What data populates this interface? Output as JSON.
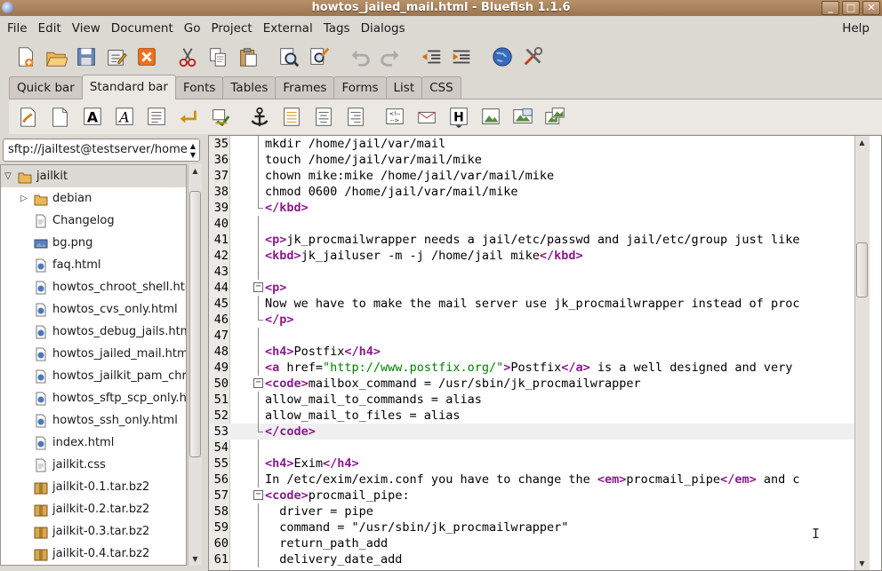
{
  "window": {
    "title": "howtos_jailed_mail.html - Bluefish 1.1.6",
    "minimize": "_",
    "maximize": "□",
    "close": "✕"
  },
  "menubar": [
    "File",
    "Edit",
    "View",
    "Document",
    "Go",
    "Project",
    "External",
    "Tags",
    "Dialogs"
  ],
  "menubar_right": "Help",
  "toolbar_icons": [
    "new-file-icon",
    "open-file-icon",
    "save-icon",
    "save-as-icon",
    "close-file-icon",
    "cut-icon",
    "copy-icon",
    "paste-icon",
    "find-icon",
    "replace-icon",
    "undo-icon",
    "redo-icon",
    "unindent-icon",
    "indent-icon",
    "preview-browser-icon",
    "preferences-icon"
  ],
  "tabs": [
    "Quick bar",
    "Standard bar",
    "Fonts",
    "Tables",
    "Frames",
    "Forms",
    "List",
    "CSS"
  ],
  "active_tab": "Standard bar",
  "tag_icons": [
    "quickstart-icon",
    "body-icon",
    "bold-icon",
    "italic-icon",
    "paragraph-icon",
    "break-icon",
    "nbsp-icon",
    "anchor-icon",
    "anchor-tag-icon",
    "align-center-icon",
    "align-right-icon",
    "comment-icon",
    "email-icon",
    "heading-icon",
    "image-icon",
    "thumbnail-icon",
    "multi-thumbnail-icon"
  ],
  "sidebar": {
    "path": "sftp://jailtest@testserver/home",
    "items": [
      {
        "label": "jailkit",
        "type": "folder",
        "expanded": true,
        "level": 0
      },
      {
        "label": "debian",
        "type": "folder",
        "expanded": false,
        "level": 1
      },
      {
        "label": "Changelog",
        "type": "text",
        "level": 1
      },
      {
        "label": "bg.png",
        "type": "image",
        "level": 1
      },
      {
        "label": "faq.html",
        "type": "html",
        "level": 1
      },
      {
        "label": "howtos_chroot_shell.htm",
        "type": "html",
        "level": 1
      },
      {
        "label": "howtos_cvs_only.html",
        "type": "html",
        "level": 1
      },
      {
        "label": "howtos_debug_jails.htm",
        "type": "html",
        "level": 1
      },
      {
        "label": "howtos_jailed_mail.htm",
        "type": "html",
        "level": 1
      },
      {
        "label": "howtos_jailkit_pam_chro",
        "type": "html",
        "level": 1
      },
      {
        "label": "howtos_sftp_scp_only.h",
        "type": "html",
        "level": 1
      },
      {
        "label": "howtos_ssh_only.html",
        "type": "html",
        "level": 1
      },
      {
        "label": "index.html",
        "type": "html",
        "level": 1
      },
      {
        "label": "jailkit.css",
        "type": "text",
        "level": 1
      },
      {
        "label": "jailkit-0.1.tar.bz2",
        "type": "archive",
        "level": 1
      },
      {
        "label": "jailkit-0.2.tar.bz2",
        "type": "archive",
        "level": 1
      },
      {
        "label": "jailkit-0.3.tar.bz2",
        "type": "archive",
        "level": 1
      },
      {
        "label": "jailkit-0.4.tar.bz2",
        "type": "archive",
        "level": 1
      }
    ]
  },
  "editor": {
    "current_line": 53,
    "lines": [
      {
        "n": "35",
        "fold": "line",
        "parts": [
          [
            "t",
            "mkdir /home/jail/var/mail"
          ]
        ]
      },
      {
        "n": "36",
        "fold": "line",
        "parts": [
          [
            "t",
            "touch /home/jail/var/mail/mike"
          ]
        ]
      },
      {
        "n": "37",
        "fold": "line",
        "parts": [
          [
            "t",
            "chown mike:mike /home/jail/var/mail/mike"
          ]
        ]
      },
      {
        "n": "38",
        "fold": "line",
        "parts": [
          [
            "t",
            "chmod 0600 /home/jail/var/mail/mike"
          ]
        ]
      },
      {
        "n": "39",
        "fold": "end",
        "parts": [
          [
            "k",
            "</kbd>"
          ]
        ]
      },
      {
        "n": "40",
        "fold": "line",
        "parts": []
      },
      {
        "n": "41",
        "fold": "line",
        "parts": [
          [
            "k",
            "<p>"
          ],
          [
            "t",
            "jk_procmailwrapper needs a jail/etc/passwd and jail/etc/group just like"
          ]
        ]
      },
      {
        "n": "42",
        "fold": "line",
        "parts": [
          [
            "k",
            "<kbd>"
          ],
          [
            "t",
            "jk_jailuser -m -j /home/jail mike"
          ],
          [
            "k",
            "</kbd>"
          ]
        ]
      },
      {
        "n": "43",
        "fold": "line",
        "parts": []
      },
      {
        "n": "44",
        "fold": "start",
        "parts": [
          [
            "k",
            "<p>"
          ]
        ]
      },
      {
        "n": "45",
        "fold": "line",
        "parts": [
          [
            "t",
            "Now we have to make the mail server use jk_procmailwrapper instead of proc"
          ]
        ]
      },
      {
        "n": "46",
        "fold": "end",
        "parts": [
          [
            "k",
            "</p>"
          ]
        ]
      },
      {
        "n": "47",
        "fold": "line",
        "parts": []
      },
      {
        "n": "48",
        "fold": "line",
        "parts": [
          [
            "k",
            "<h4>"
          ],
          [
            "t",
            "Postfix"
          ],
          [
            "k",
            "</h4>"
          ]
        ]
      },
      {
        "n": "49",
        "fold": "line",
        "parts": [
          [
            "k",
            "<a "
          ],
          [
            "a",
            "href="
          ],
          [
            "v",
            "\"http://www.postfix.org/\""
          ],
          [
            "k",
            ">"
          ],
          [
            "t",
            "Postfix"
          ],
          [
            "k",
            "</a>"
          ],
          [
            "t",
            " is a well designed and very"
          ]
        ]
      },
      {
        "n": "50",
        "fold": "start",
        "parts": [
          [
            "k",
            "<code>"
          ],
          [
            "t",
            "mailbox_command = /usr/sbin/jk_procmailwrapper"
          ]
        ]
      },
      {
        "n": "51",
        "fold": "line",
        "parts": [
          [
            "t",
            "allow_mail_to_commands = alias"
          ]
        ]
      },
      {
        "n": "52",
        "fold": "line",
        "parts": [
          [
            "t",
            "allow_mail_to_files = alias"
          ]
        ]
      },
      {
        "n": "53",
        "fold": "end",
        "parts": [
          [
            "k",
            "</code>"
          ]
        ]
      },
      {
        "n": "54",
        "fold": "line",
        "parts": []
      },
      {
        "n": "55",
        "fold": "line",
        "parts": [
          [
            "k",
            "<h4>"
          ],
          [
            "t",
            "Exim"
          ],
          [
            "k",
            "</h4>"
          ]
        ]
      },
      {
        "n": "56",
        "fold": "line",
        "parts": [
          [
            "t",
            "In /etc/exim/exim.conf you have to change the "
          ],
          [
            "k",
            "<em>"
          ],
          [
            "t",
            "procmail_pipe"
          ],
          [
            "k",
            "</em>"
          ],
          [
            "t",
            " and c"
          ]
        ]
      },
      {
        "n": "57",
        "fold": "start",
        "parts": [
          [
            "k",
            "<code>"
          ],
          [
            "t",
            "procmail_pipe:"
          ]
        ]
      },
      {
        "n": "58",
        "fold": "line",
        "parts": [
          [
            "t",
            "  driver = pipe"
          ]
        ]
      },
      {
        "n": "59",
        "fold": "line",
        "parts": [
          [
            "t",
            "  command = \"/usr/sbin/jk_procmailwrapper\""
          ]
        ]
      },
      {
        "n": "60",
        "fold": "line",
        "parts": [
          [
            "t",
            "  return_path_add"
          ]
        ]
      },
      {
        "n": "61",
        "fold": "line",
        "parts": [
          [
            "t",
            "  delivery_date_add"
          ]
        ]
      }
    ]
  },
  "colors": {
    "tag": "#8b1a8b",
    "attr_value": "#008000",
    "titlebar": "#a98260"
  }
}
